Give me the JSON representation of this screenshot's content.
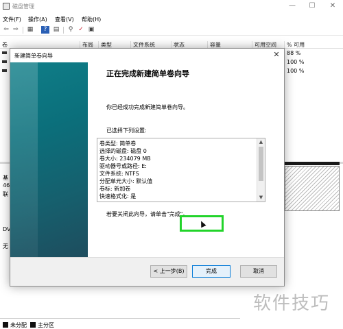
{
  "window": {
    "title": "磁盘管理",
    "controls": {
      "minimize": "—",
      "maximize": "☐",
      "close": "✕"
    }
  },
  "menu": [
    "文件(F)",
    "操作(A)",
    "查看(V)",
    "帮助(H)"
  ],
  "toolbar": {
    "icons": [
      "back-arrow-icon",
      "forward-arrow-icon",
      "console-tree-icon",
      "help-icon",
      "properties-icon",
      "connect-icon",
      "check-icon",
      "list-icon"
    ],
    "glyphs": [
      "⇦",
      "⇨",
      "▦",
      "?",
      "▤",
      "⚲",
      "✓",
      "▣"
    ]
  },
  "columns": [
    "卷",
    "布局",
    "类型",
    "文件系统",
    "状态",
    "容量",
    "可用空间",
    "% 可用"
  ],
  "volumes": [
    {
      "pct": "88 %"
    },
    {
      "pct": "100 %"
    },
    {
      "pct": "100 %"
    }
  ],
  "disks": [
    {
      "line1": "基",
      "line2": "46",
      "line3": "联"
    },
    {
      "line1": "DV",
      "line2": "",
      "line3": "无"
    }
  ],
  "legend": [
    {
      "label": "未分配",
      "color": "#111111"
    },
    {
      "label": "主分区",
      "color": "#111111"
    }
  ],
  "watermark": "软件技巧",
  "dialog": {
    "title": "新建简单卷向导",
    "close_glyph": "✕",
    "heading": "正在完成新建简单卷向导",
    "message": "你已经成功完成新建简单卷向导。",
    "settings_label": "已选择下列设置:",
    "settings": [
      "卷类型: 简单卷",
      "选择的磁盘: 磁盘 0",
      "卷大小: 234079 MB",
      "驱动器号或路径: E:",
      "文件系统: NTFS",
      "分配单元大小: 默认值",
      "卷标: 新加卷",
      "快速格式化: 是"
    ],
    "close_hint": "若要关闭此向导，请单击\"完成\"。",
    "buttons": {
      "back": "< 上一步(B)",
      "finish": "完成",
      "cancel": "取消"
    },
    "colors": {
      "banner": "#0f7e88",
      "highlight": "#22d42a"
    }
  }
}
